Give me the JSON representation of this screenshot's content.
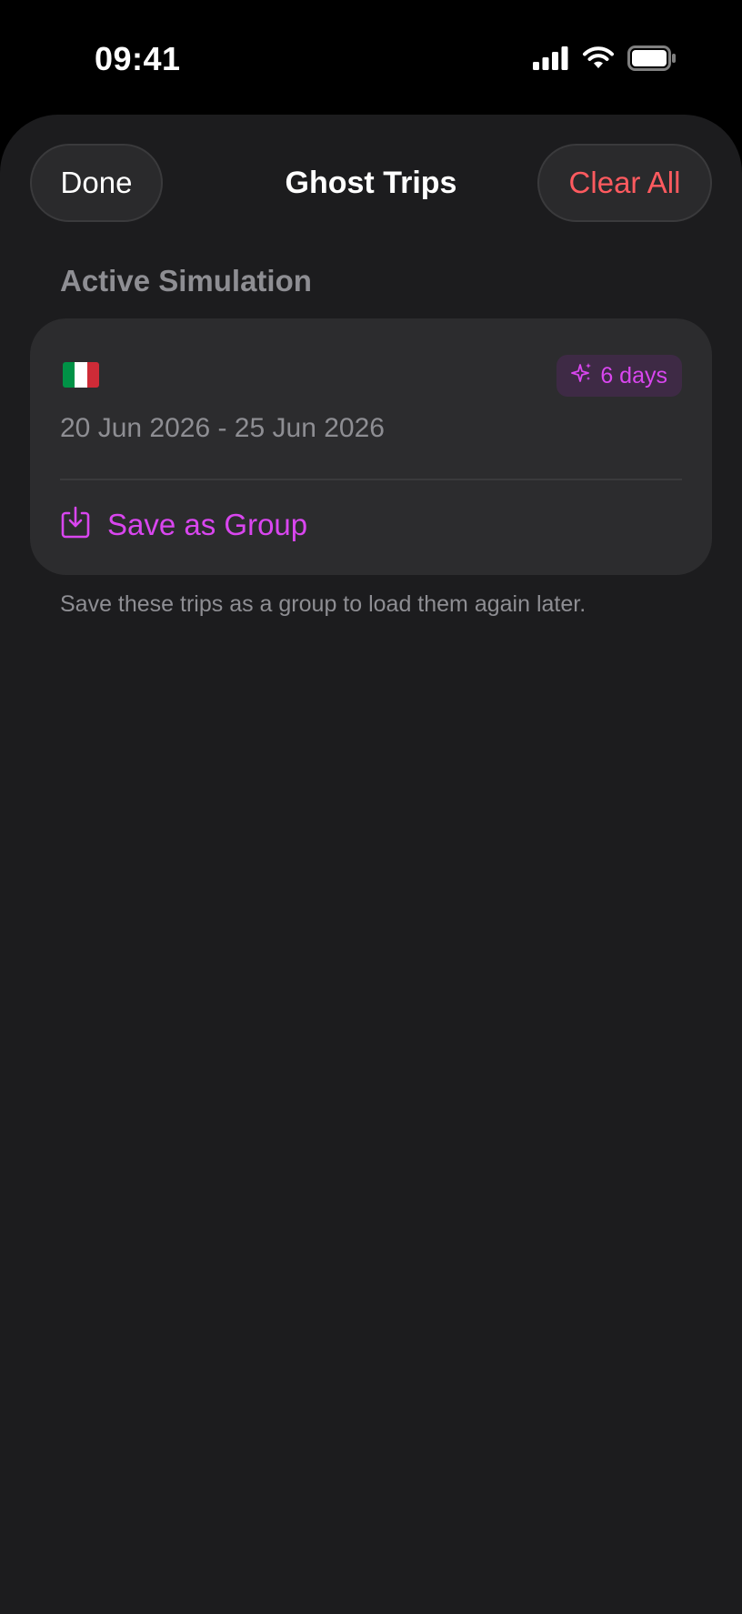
{
  "status_bar": {
    "time": "09:41",
    "icons": [
      "signal-icon",
      "wifi-icon",
      "battery-icon"
    ]
  },
  "header": {
    "done_label": "Done",
    "title": "Ghost Trips",
    "clear_label": "Clear All"
  },
  "section": {
    "title": "Active Simulation"
  },
  "trip_card": {
    "flag_icon": "italy-flag-icon",
    "badge_label": "6 days",
    "badge_icon": "sparkles-icon",
    "date_range": "20 Jun 2026 - 25 Jun 2026",
    "action_label": "Save as Group",
    "action_icon": "save-download-icon"
  },
  "footnote": "Save these trips as a group to load them again later.",
  "colors": {
    "accent": "#d946ef",
    "destructive": "#ff5a5f",
    "background": "#1c1c1e",
    "card": "#2c2c2e",
    "secondary_text": "#8e8e93"
  }
}
